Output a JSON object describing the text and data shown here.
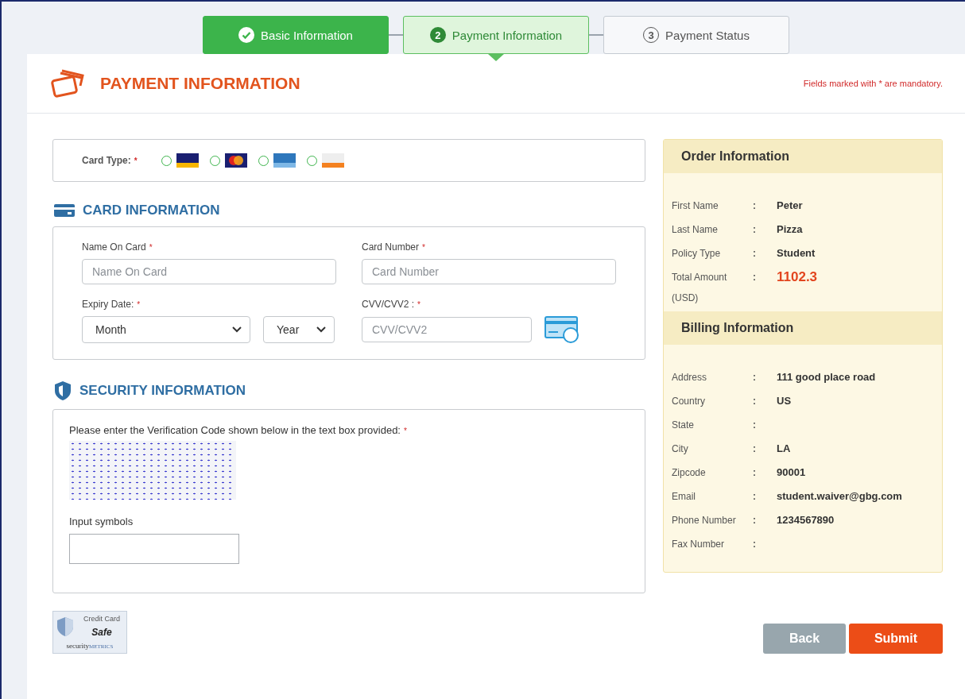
{
  "steps": [
    {
      "kind": "done",
      "label": "Basic Information"
    },
    {
      "kind": "current",
      "number": "2",
      "label": "Payment Information"
    },
    {
      "kind": "pending",
      "number": "3",
      "label": "Payment Status"
    }
  ],
  "header": {
    "title": "PAYMENT INFORMATION",
    "notice": "Fields marked with * are mandatory."
  },
  "card_type": {
    "label": "Card Type:",
    "mark": "*",
    "options": [
      {
        "kind": "visa",
        "selected": false
      },
      {
        "kind": "mastercard",
        "selected": false
      },
      {
        "kind": "amex",
        "selected": false
      },
      {
        "kind": "discover",
        "selected": false
      }
    ]
  },
  "card_information": {
    "title": "CARD INFORMATION",
    "fields": [
      {
        "kind": "text",
        "label": "Name On Card",
        "mark": "*",
        "placeholder": "Name On Card"
      },
      {
        "kind": "text",
        "label": "Card Number",
        "mark": "*",
        "placeholder": "Card Number"
      },
      {
        "kind": "expiry",
        "label": "Expiry Date:",
        "mark": "*",
        "selects": [
          "Month",
          "Year"
        ]
      },
      {
        "kind": "cvv",
        "label": "CVV/CVV2 :",
        "mark": "*",
        "placeholder": "CVV/CVV2"
      }
    ]
  },
  "security_information": {
    "title": "SECURITY INFORMATION",
    "prompt": "Please enter the Verification Code shown below in the text box provided:",
    "mark": "*",
    "input_label": "Input symbols"
  },
  "badge": {
    "line_1": "Credit Card",
    "line_2": "Safe",
    "line_3": "security",
    "line_4": "METRICS"
  },
  "order_information": {
    "title": "Order Information",
    "rows": [
      {
        "label": "First Name",
        "separator": ":",
        "value": "Peter",
        "highlight": false
      },
      {
        "label": "Last Name",
        "separator": ":",
        "value": "Pizza",
        "highlight": false
      },
      {
        "label": "Policy Type",
        "separator": ":",
        "value": "Student",
        "highlight": false
      },
      {
        "label": "Total Amount",
        "separator": ":",
        "value": "1102.3",
        "highlight": true,
        "note": "(USD)"
      }
    ]
  },
  "billing_information": {
    "title": "Billing Information",
    "rows": [
      {
        "label": "Address",
        "separator": ":",
        "value": "111 good place road"
      },
      {
        "label": "Country",
        "separator": ":",
        "value": "US"
      },
      {
        "label": "State",
        "separator": ":"
      },
      {
        "label": "City",
        "separator": ":",
        "value": "LA"
      },
      {
        "label": "Zipcode",
        "separator": ":",
        "value": "90001"
      },
      {
        "label": "Email",
        "separator": ":",
        "value": "student.waiver@gbg.com"
      },
      {
        "label": "Phone Number",
        "separator": ":",
        "value": "1234567890"
      },
      {
        "label": "Fax Number",
        "separator": ":"
      }
    ]
  },
  "buttons": [
    {
      "kind": "secondary",
      "label": "Back"
    },
    {
      "kind": "primary",
      "label": "Submit"
    }
  ]
}
